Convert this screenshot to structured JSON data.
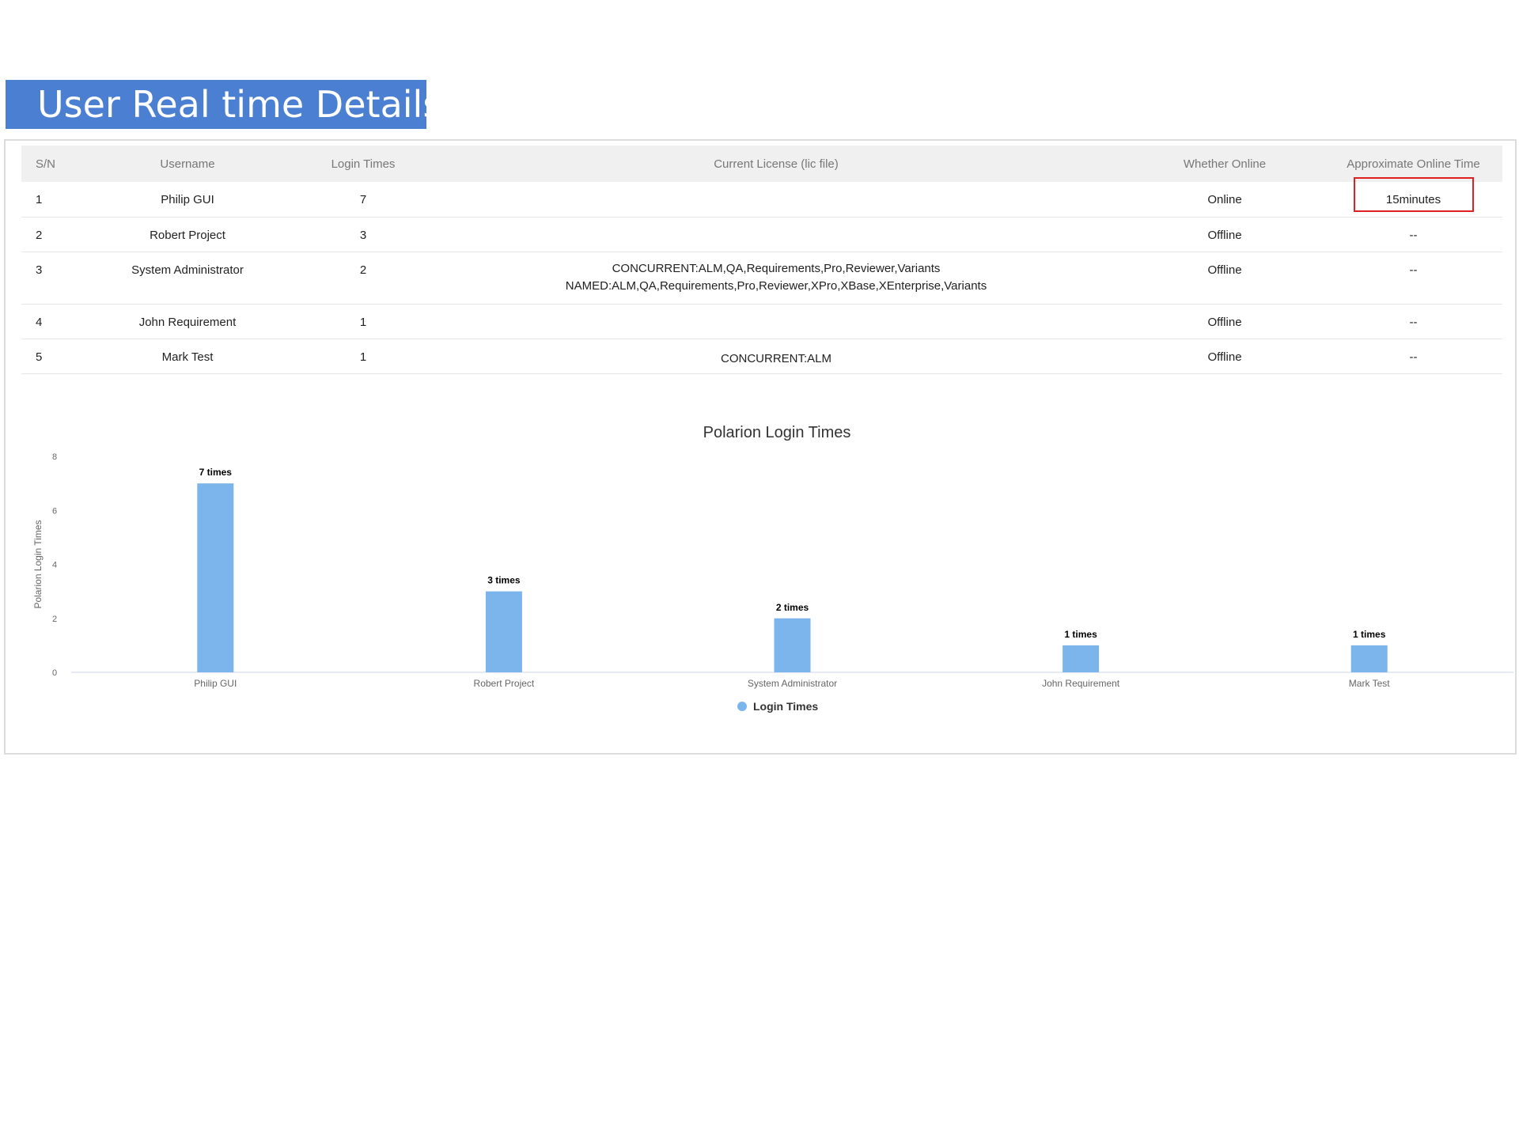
{
  "banner": {
    "title": "User Real time Details"
  },
  "table": {
    "headers": {
      "sn": "S/N",
      "username": "Username",
      "login_times": "Login Times",
      "license": "Current License  (lic file)",
      "online": "Whether Online",
      "time": "Approximate Online Time"
    },
    "rows": [
      {
        "sn": "1",
        "username": "Philip GUI",
        "login_times": "7",
        "license": [
          "",
          ""
        ],
        "online": "Online",
        "time": "15minutes"
      },
      {
        "sn": "2",
        "username": "Robert Project",
        "login_times": "3",
        "license": [
          "",
          ""
        ],
        "online": "Offline",
        "time": "--"
      },
      {
        "sn": "3",
        "username": "System Administrator",
        "login_times": "2",
        "license": [
          "CONCURRENT:ALM,QA,Requirements,Pro,Reviewer,Variants",
          "NAMED:ALM,QA,Requirements,Pro,Reviewer,XPro,XBase,XEnterprise,Variants"
        ],
        "online": "Offline",
        "time": "--"
      },
      {
        "sn": "4",
        "username": "John Requirement",
        "login_times": "1",
        "license": [
          "",
          ""
        ],
        "online": "Offline",
        "time": "--"
      },
      {
        "sn": "5",
        "username": "Mark Test",
        "login_times": "1",
        "license": [
          "CONCURRENT:ALM",
          ""
        ],
        "online": "Offline",
        "time": "--"
      }
    ]
  },
  "colors": {
    "banner": "#4a7fd2",
    "bar": "#7cb5ec",
    "highlight_border": "#e02020"
  },
  "chart_data": {
    "type": "bar",
    "title": "Polarion Login Times",
    "xlabel": "",
    "ylabel": "Polarion Login Times",
    "categories": [
      "Philip GUI",
      "Robert Project",
      "System Administrator",
      "John Requirement",
      "Mark Test"
    ],
    "series": [
      {
        "name": "Login Times",
        "values": [
          7,
          3,
          2,
          1,
          1
        ]
      }
    ],
    "data_labels": [
      "7 times",
      "3 times",
      "2 times",
      "1 times",
      "1 times"
    ],
    "yticks": [
      "0",
      "2",
      "4",
      "6",
      "8"
    ],
    "ylim": [
      0,
      8
    ],
    "legend_position": "bottom-center",
    "grid": false
  }
}
